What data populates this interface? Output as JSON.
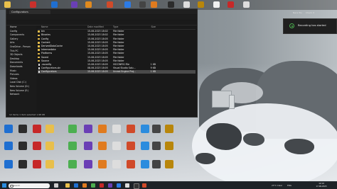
{
  "explorer": {
    "tab_title": "Configurators",
    "address": "This PC  >  New Volume (E:)  >  MyGames  >  Configurators",
    "search_placeholder": "Search Configurators",
    "nav_items": [
      "Home",
      "Config",
      "Components",
      "Gallery",
      "Arts",
      "OneDrive - Person",
      "This PC",
      "3D Objects",
      "Desktop",
      "Documents",
      "Downloads",
      "Music",
      "Pictures",
      "Videos",
      "Local Disk (C:)",
      "New Volume (D:)",
      "New Volume (E:)",
      "Network"
    ],
    "headers": {
      "name": "Name",
      "date": "Date modified",
      "type": "Type",
      "size": "Size"
    },
    "rows": [
      {
        "name": "bin",
        "date": "15-06-2023 18:02",
        "type": "File folder",
        "size": "",
        "kind": "folder"
      },
      {
        "name": "Binaries",
        "date": "15-06-2023 18:02",
        "type": "File folder",
        "size": "",
        "kind": "folder"
      },
      {
        "name": "Config",
        "date": "15-06-2023 18:05",
        "type": "File folder",
        "size": "",
        "kind": "folder"
      },
      {
        "name": "Content",
        "date": "15-06-2023 18:05",
        "type": "File folder",
        "size": "",
        "kind": "folder"
      },
      {
        "name": "DerivedDataCache",
        "date": "10-06-2023 18:05",
        "type": "File folder",
        "size": "",
        "kind": "folder"
      },
      {
        "name": "Intermediate",
        "date": "15-06-2023 18:05",
        "type": "File folder",
        "size": "",
        "kind": "folder"
      },
      {
        "name": "Platforms",
        "date": "15-06-2023 18:05",
        "type": "File folder",
        "size": "",
        "kind": "folder"
      },
      {
        "name": "Saved",
        "date": "15-06-2023 18:05",
        "type": "File folder",
        "size": "",
        "kind": "folder"
      },
      {
        "name": "Source",
        "date": "15-06-2023 18:05",
        "type": "File folder",
        "size": "",
        "kind": "folder"
      },
      {
        "name": ".vsconfig",
        "date": "15-06-2023 18:05",
        "type": "VSCONFIG File",
        "size": "1 KB",
        "kind": "file"
      },
      {
        "name": "Configurators.sln",
        "date": "08-06-2023 18:05",
        "type": "Visual Studio Solu...",
        "size": "9 KB",
        "kind": "file"
      },
      {
        "name": "Configurators",
        "date": "15-06-2023 18:05",
        "type": "Unreal Engine Proj...",
        "size": "1 KB",
        "kind": "file",
        "selected": true
      }
    ],
    "status": "12 items    1 item selected  1.98 KB"
  },
  "notification": {
    "text": "Recording has started"
  },
  "profile": {
    "name": "Nara Wu",
    "action": "Check it"
  },
  "taskbar": {
    "search_placeholder": "Search",
    "tray_text": "23°C  Clear",
    "lang": "ENG",
    "time": "12:19",
    "date": "17-06-2023"
  },
  "colors": {
    "accent": "#2b8cde",
    "folder": "#e8bf4b",
    "recording": "#4caf50"
  }
}
